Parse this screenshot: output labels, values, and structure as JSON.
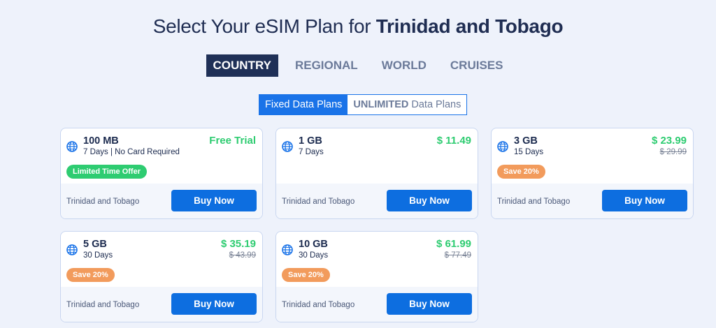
{
  "header": {
    "title_prefix": "Select Your eSIM Plan for",
    "title_country": "Trinidad and Tobago"
  },
  "tabs": [
    {
      "label": "COUNTRY",
      "active": true
    },
    {
      "label": "REGIONAL",
      "active": false
    },
    {
      "label": "WORLD",
      "active": false
    },
    {
      "label": "CRUISES",
      "active": false
    }
  ],
  "plan_toggle": {
    "fixed": "Fixed Data Plans",
    "unlimited_bold": "UNLIMITED",
    "unlimited_rest": "Data Plans"
  },
  "colors": {
    "accent": "#1a73e8",
    "price_green": "#2ecc71",
    "badge_orange": "#f29b5c",
    "nav_active": "#1f3057"
  },
  "icons": {
    "card_icon": "globe-icon"
  },
  "plans": [
    {
      "data": "100 MB",
      "duration": "7 Days | No Card Required",
      "price": "Free Trial",
      "old_price": "",
      "badge": "Limited Time Offer",
      "badge_color": "green",
      "country": "Trinidad and Tobago",
      "button": "Buy Now"
    },
    {
      "data": "1 GB",
      "duration": "7 Days",
      "price": "$ 11.49",
      "old_price": "",
      "badge": "",
      "badge_color": "",
      "country": "Trinidad and Tobago",
      "button": "Buy Now"
    },
    {
      "data": "3 GB",
      "duration": "15 Days",
      "price": "$ 23.99",
      "old_price": "$ 29.99",
      "badge": "Save 20%",
      "badge_color": "orange",
      "country": "Trinidad and Tobago",
      "button": "Buy Now"
    },
    {
      "data": "5 GB",
      "duration": "30 Days",
      "price": "$ 35.19",
      "old_price": "$ 43.99",
      "badge": "Save 20%",
      "badge_color": "orange",
      "country": "Trinidad and Tobago",
      "button": "Buy Now"
    },
    {
      "data": "10 GB",
      "duration": "30 Days",
      "price": "$ 61.99",
      "old_price": "$ 77.49",
      "badge": "Save 20%",
      "badge_color": "orange",
      "country": "Trinidad and Tobago",
      "button": "Buy Now"
    }
  ]
}
